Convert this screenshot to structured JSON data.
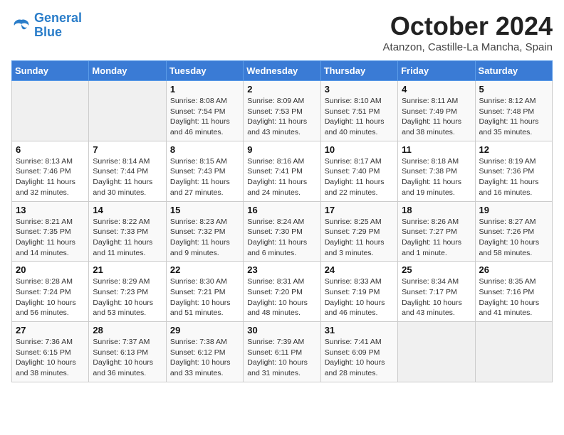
{
  "header": {
    "logo_line1": "General",
    "logo_line2": "Blue",
    "month": "October 2024",
    "location": "Atanzon, Castille-La Mancha, Spain"
  },
  "days_of_week": [
    "Sunday",
    "Monday",
    "Tuesday",
    "Wednesday",
    "Thursday",
    "Friday",
    "Saturday"
  ],
  "weeks": [
    [
      {
        "day": "",
        "info": ""
      },
      {
        "day": "",
        "info": ""
      },
      {
        "day": "1",
        "info": "Sunrise: 8:08 AM\nSunset: 7:54 PM\nDaylight: 11 hours and 46 minutes."
      },
      {
        "day": "2",
        "info": "Sunrise: 8:09 AM\nSunset: 7:53 PM\nDaylight: 11 hours and 43 minutes."
      },
      {
        "day": "3",
        "info": "Sunrise: 8:10 AM\nSunset: 7:51 PM\nDaylight: 11 hours and 40 minutes."
      },
      {
        "day": "4",
        "info": "Sunrise: 8:11 AM\nSunset: 7:49 PM\nDaylight: 11 hours and 38 minutes."
      },
      {
        "day": "5",
        "info": "Sunrise: 8:12 AM\nSunset: 7:48 PM\nDaylight: 11 hours and 35 minutes."
      }
    ],
    [
      {
        "day": "6",
        "info": "Sunrise: 8:13 AM\nSunset: 7:46 PM\nDaylight: 11 hours and 32 minutes."
      },
      {
        "day": "7",
        "info": "Sunrise: 8:14 AM\nSunset: 7:44 PM\nDaylight: 11 hours and 30 minutes."
      },
      {
        "day": "8",
        "info": "Sunrise: 8:15 AM\nSunset: 7:43 PM\nDaylight: 11 hours and 27 minutes."
      },
      {
        "day": "9",
        "info": "Sunrise: 8:16 AM\nSunset: 7:41 PM\nDaylight: 11 hours and 24 minutes."
      },
      {
        "day": "10",
        "info": "Sunrise: 8:17 AM\nSunset: 7:40 PM\nDaylight: 11 hours and 22 minutes."
      },
      {
        "day": "11",
        "info": "Sunrise: 8:18 AM\nSunset: 7:38 PM\nDaylight: 11 hours and 19 minutes."
      },
      {
        "day": "12",
        "info": "Sunrise: 8:19 AM\nSunset: 7:36 PM\nDaylight: 11 hours and 16 minutes."
      }
    ],
    [
      {
        "day": "13",
        "info": "Sunrise: 8:21 AM\nSunset: 7:35 PM\nDaylight: 11 hours and 14 minutes."
      },
      {
        "day": "14",
        "info": "Sunrise: 8:22 AM\nSunset: 7:33 PM\nDaylight: 11 hours and 11 minutes."
      },
      {
        "day": "15",
        "info": "Sunrise: 8:23 AM\nSunset: 7:32 PM\nDaylight: 11 hours and 9 minutes."
      },
      {
        "day": "16",
        "info": "Sunrise: 8:24 AM\nSunset: 7:30 PM\nDaylight: 11 hours and 6 minutes."
      },
      {
        "day": "17",
        "info": "Sunrise: 8:25 AM\nSunset: 7:29 PM\nDaylight: 11 hours and 3 minutes."
      },
      {
        "day": "18",
        "info": "Sunrise: 8:26 AM\nSunset: 7:27 PM\nDaylight: 11 hours and 1 minute."
      },
      {
        "day": "19",
        "info": "Sunrise: 8:27 AM\nSunset: 7:26 PM\nDaylight: 10 hours and 58 minutes."
      }
    ],
    [
      {
        "day": "20",
        "info": "Sunrise: 8:28 AM\nSunset: 7:24 PM\nDaylight: 10 hours and 56 minutes."
      },
      {
        "day": "21",
        "info": "Sunrise: 8:29 AM\nSunset: 7:23 PM\nDaylight: 10 hours and 53 minutes."
      },
      {
        "day": "22",
        "info": "Sunrise: 8:30 AM\nSunset: 7:21 PM\nDaylight: 10 hours and 51 minutes."
      },
      {
        "day": "23",
        "info": "Sunrise: 8:31 AM\nSunset: 7:20 PM\nDaylight: 10 hours and 48 minutes."
      },
      {
        "day": "24",
        "info": "Sunrise: 8:33 AM\nSunset: 7:19 PM\nDaylight: 10 hours and 46 minutes."
      },
      {
        "day": "25",
        "info": "Sunrise: 8:34 AM\nSunset: 7:17 PM\nDaylight: 10 hours and 43 minutes."
      },
      {
        "day": "26",
        "info": "Sunrise: 8:35 AM\nSunset: 7:16 PM\nDaylight: 10 hours and 41 minutes."
      }
    ],
    [
      {
        "day": "27",
        "info": "Sunrise: 7:36 AM\nSunset: 6:15 PM\nDaylight: 10 hours and 38 minutes."
      },
      {
        "day": "28",
        "info": "Sunrise: 7:37 AM\nSunset: 6:13 PM\nDaylight: 10 hours and 36 minutes."
      },
      {
        "day": "29",
        "info": "Sunrise: 7:38 AM\nSunset: 6:12 PM\nDaylight: 10 hours and 33 minutes."
      },
      {
        "day": "30",
        "info": "Sunrise: 7:39 AM\nSunset: 6:11 PM\nDaylight: 10 hours and 31 minutes."
      },
      {
        "day": "31",
        "info": "Sunrise: 7:41 AM\nSunset: 6:09 PM\nDaylight: 10 hours and 28 minutes."
      },
      {
        "day": "",
        "info": ""
      },
      {
        "day": "",
        "info": ""
      }
    ]
  ]
}
